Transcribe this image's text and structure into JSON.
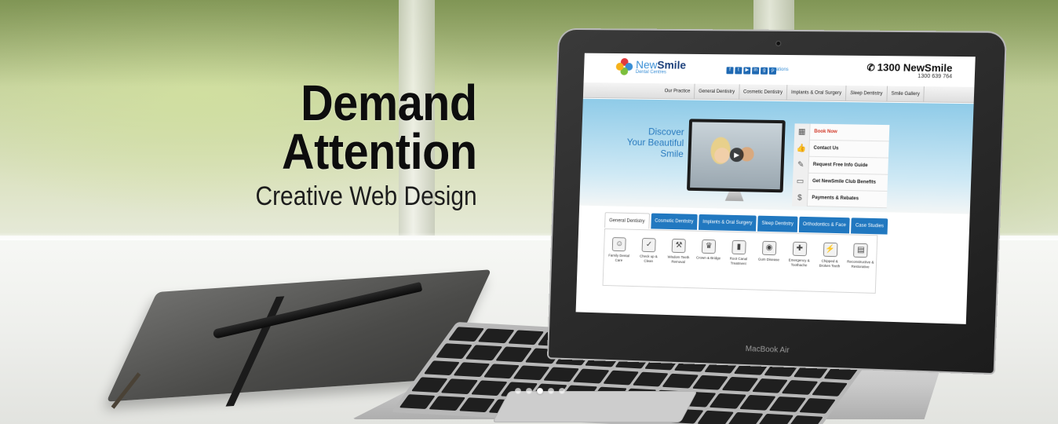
{
  "headline": {
    "line1": "Demand",
    "line2": "Attention",
    "subtitle": "Creative Web Design"
  },
  "laptop": {
    "brand": "MacBook Air"
  },
  "site": {
    "logo": {
      "brand_dark": "New",
      "brand_bold": "Smile",
      "tagline": "Dental Centres"
    },
    "social_icons": [
      "facebook-icon",
      "twitter-icon",
      "youtube-icon",
      "linkedin-icon",
      "google-plus-icon",
      "pinterest-icon"
    ],
    "locations_link": "Locations",
    "phone": {
      "number": "1300 NewSmile",
      "alt": "1300 639 764"
    },
    "nav": [
      "Our Practice",
      "General Dentistry",
      "Cosmetic Dentistry",
      "Implants & Oral Surgery",
      "Sleep Dentistry",
      "Smile Gallery"
    ],
    "hero": {
      "line1": "Discover",
      "line2": "Your Beautiful",
      "line3": "Smile"
    },
    "quick_links": [
      {
        "icon": "calendar-icon",
        "label": "Book Now",
        "accent": true
      },
      {
        "icon": "thumbs-up-icon",
        "label": "Contact Us",
        "accent": false
      },
      {
        "icon": "tooth-guide-icon",
        "label": "Request Free Info Guide",
        "accent": false
      },
      {
        "icon": "card-icon",
        "label": "Get NewSmile Club Benefits",
        "accent": false
      },
      {
        "icon": "dollar-icon",
        "label": "Payments & Rebates",
        "accent": false
      }
    ],
    "tabs": [
      "General Dentistry",
      "Cosmetic Dentistry",
      "Implants & Oral Surgery",
      "Sleep Dentistry",
      "Orthodontics & Face",
      "Case Studies"
    ],
    "active_tab": 0,
    "services": [
      {
        "icon": "family-icon",
        "label": "Family Dental Care"
      },
      {
        "icon": "checkup-icon",
        "label": "Check up & Clean"
      },
      {
        "icon": "wisdom-tooth-icon",
        "label": "Wisdom Teeth Removal"
      },
      {
        "icon": "crown-icon",
        "label": "Crown & Bridge"
      },
      {
        "icon": "root-canal-icon",
        "label": "Root Canal Treatment"
      },
      {
        "icon": "gum-icon",
        "label": "Gum Disease"
      },
      {
        "icon": "emergency-icon",
        "label": "Emergency & Toothache"
      },
      {
        "icon": "broken-tooth-icon",
        "label": "Chipped & Broken Teeth"
      },
      {
        "icon": "reconstructive-icon",
        "label": "Reconstructive & Restorative"
      }
    ]
  },
  "slider": {
    "count": 5,
    "active": 2
  },
  "colors": {
    "site_blue": "#2178c0",
    "headline": "#0d0d0d",
    "accent_red": "#d23a2a"
  }
}
